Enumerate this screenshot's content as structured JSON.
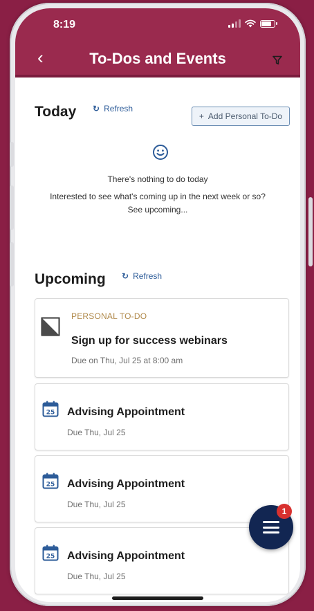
{
  "status_bar": {
    "time": "8:19"
  },
  "header": {
    "title": "To-Dos and Events"
  },
  "today": {
    "title": "Today",
    "refresh_label": "Refresh",
    "add_label": "Add Personal To-Do",
    "empty_title": "There's nothing to do today",
    "empty_prompt": "Interested to see what's coming up in the next week or so?",
    "see_upcoming": "See upcoming..."
  },
  "upcoming": {
    "title": "Upcoming",
    "refresh_label": "Refresh",
    "todo": {
      "tag": "PERSONAL TO-DO",
      "title": "Sign up for success webinars",
      "due": "Due on Thu, Jul 25 at 8:00 am"
    },
    "appointments": [
      {
        "title": "Advising Appointment",
        "due": "Due Thu, Jul 25",
        "day": "25"
      },
      {
        "title": "Advising Appointment",
        "due": "Due Thu, Jul 25",
        "day": "25"
      },
      {
        "title": "Advising Appointment",
        "due": "Due Thu, Jul 25",
        "day": "25"
      }
    ]
  },
  "fab": {
    "badge": "1"
  },
  "colors": {
    "brand": "#9a2a4e",
    "background": "#8a1f45",
    "link": "#2d5c99",
    "tag": "#b0894a",
    "fab": "#122652",
    "badge": "#d8312f"
  },
  "icons": {
    "back": "chevron-left-icon",
    "filter": "filter-icon",
    "refresh": "refresh-icon",
    "add": "plus-icon",
    "empty": "smiley-icon",
    "todo": "todo-checkbox-icon",
    "appointment": "calendar-icon",
    "menu": "hamburger-menu-icon"
  }
}
